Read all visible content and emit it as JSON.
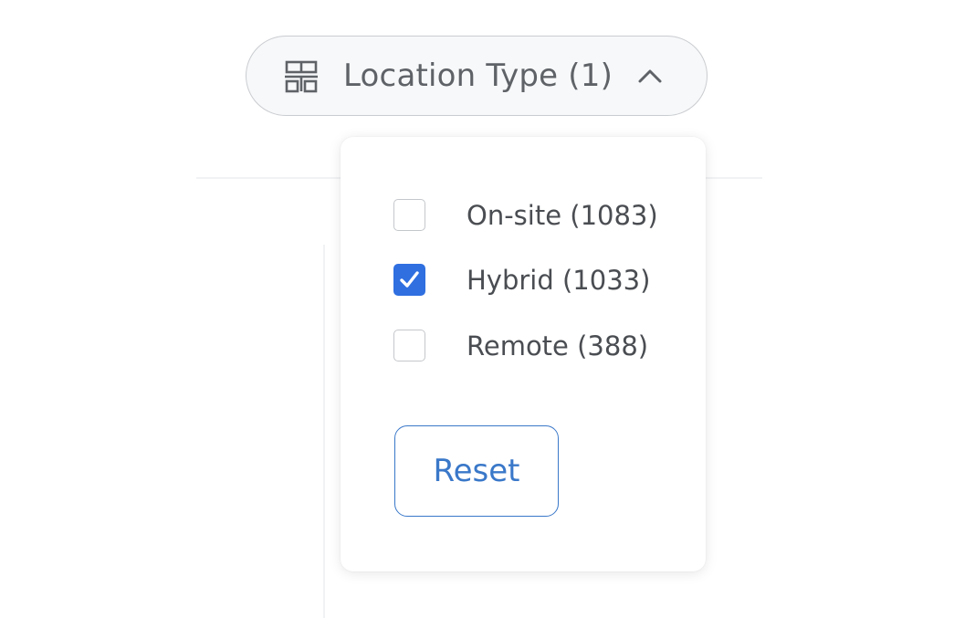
{
  "filter": {
    "label": "Location Type (1)",
    "icon": "location-type-icon",
    "expanded": true,
    "chevron_icon": "chevron-up-icon"
  },
  "dropdown": {
    "options": [
      {
        "label": "On-site (1083)",
        "checked": false
      },
      {
        "label": "Hybrid (1033)",
        "checked": true
      },
      {
        "label": "Remote (388)",
        "checked": false
      }
    ],
    "reset_label": "Reset"
  },
  "colors": {
    "accent": "#2f6fe0",
    "reset_text": "#3a78c9",
    "label_text": "#5f6368"
  }
}
